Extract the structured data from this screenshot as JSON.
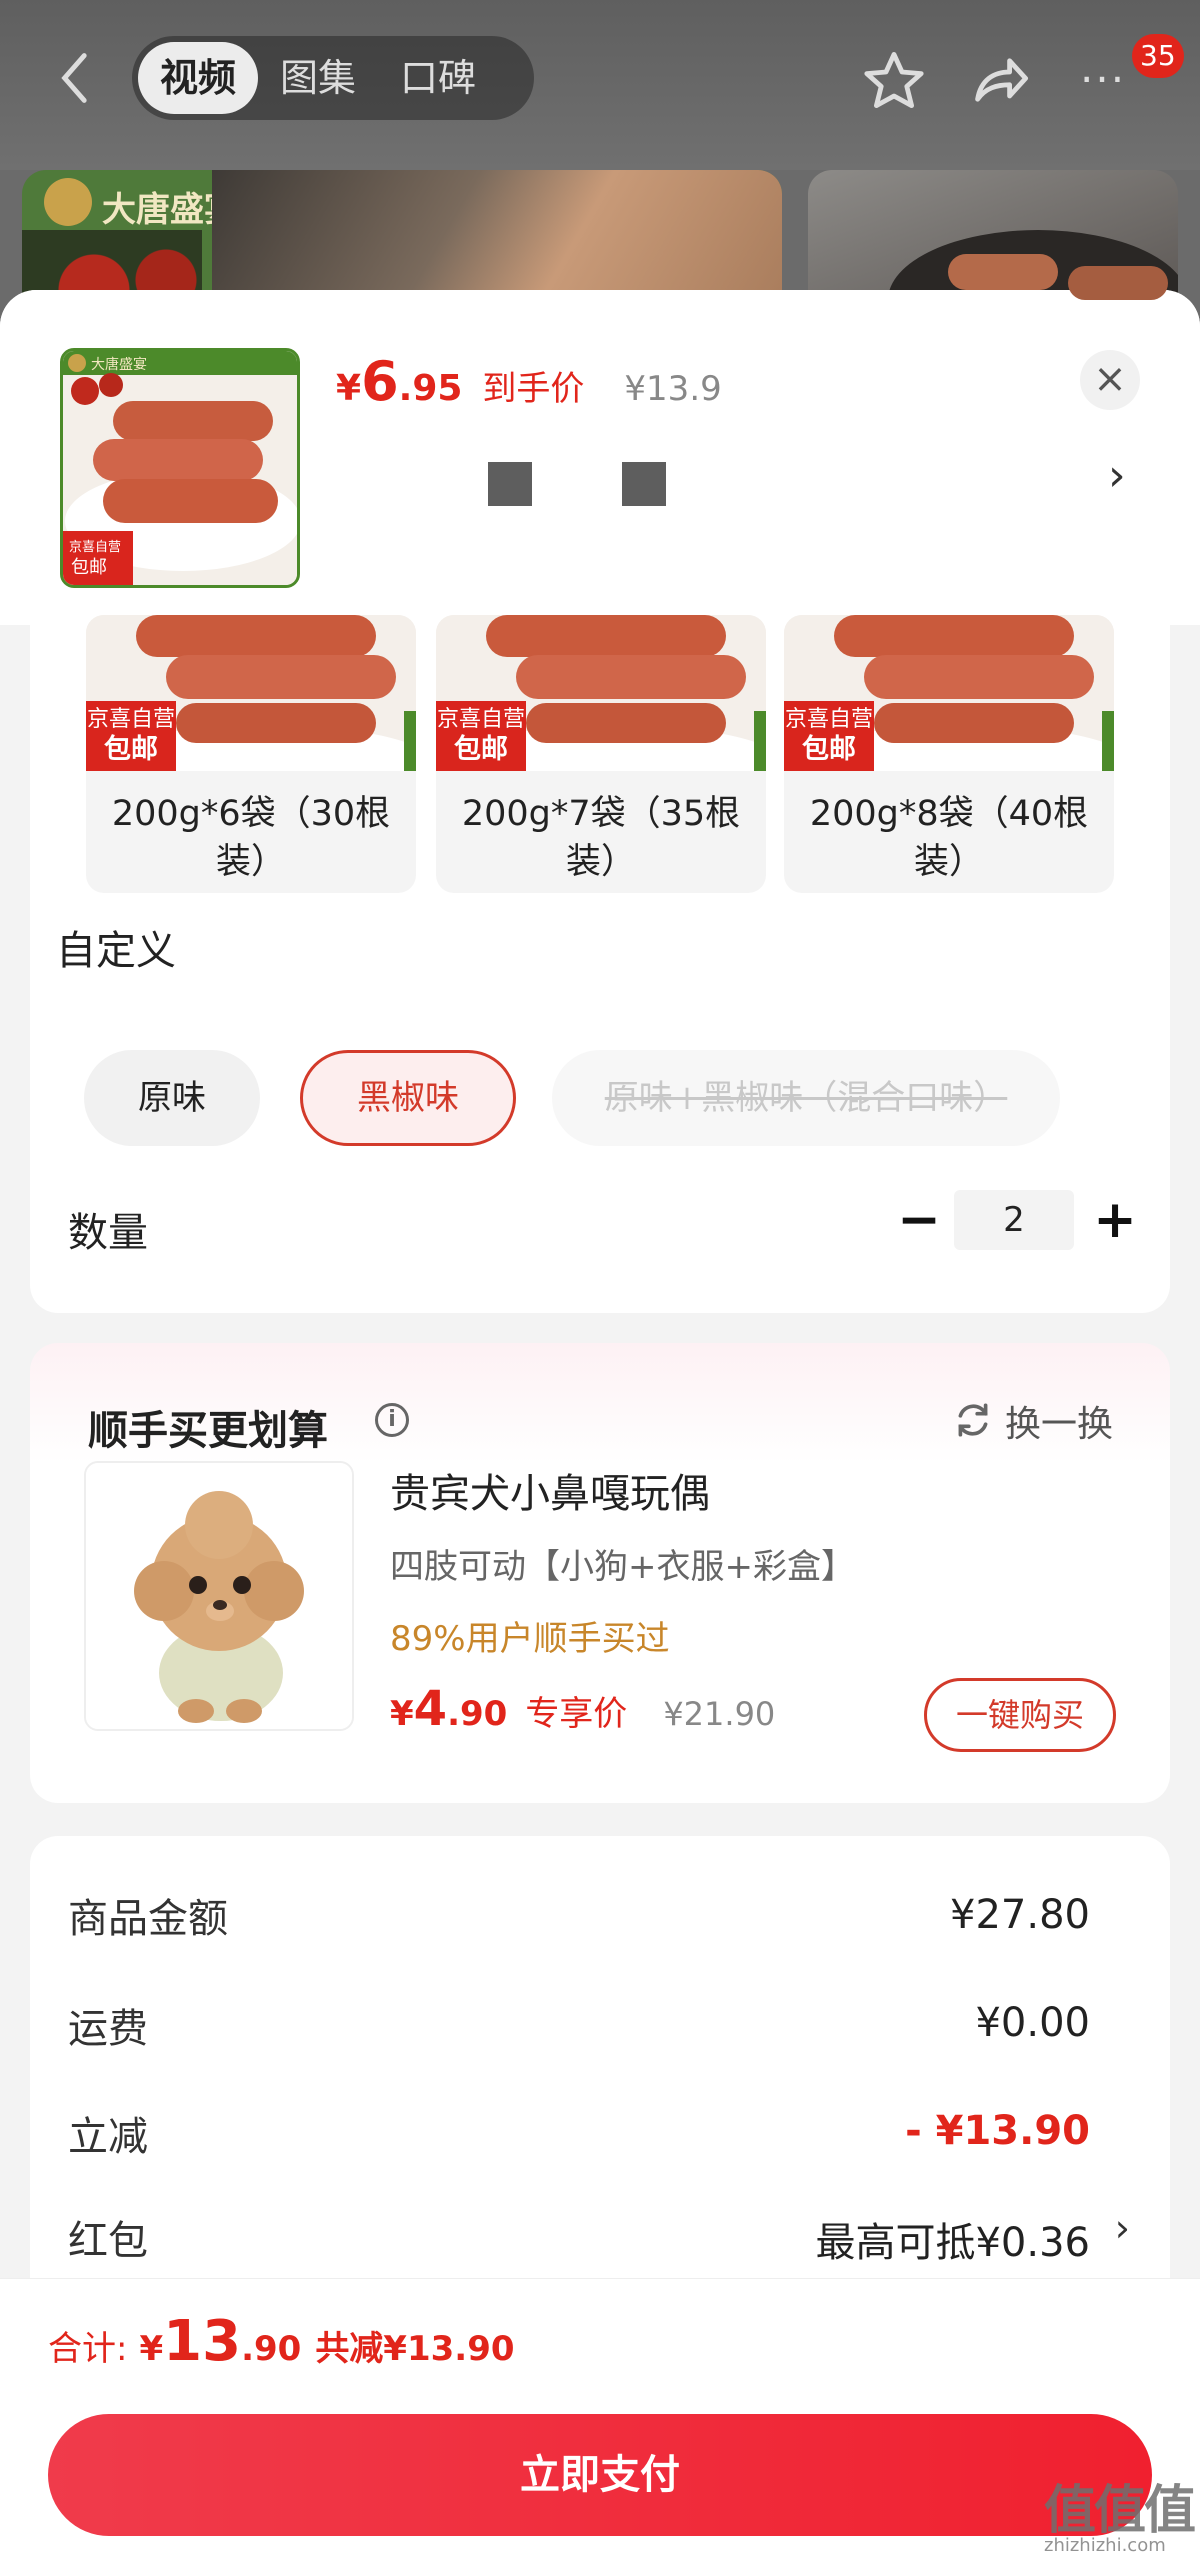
{
  "top_nav": {
    "tabs": [
      "视频",
      "图集",
      "口碑"
    ],
    "active_tab": 0,
    "badge_count": "35",
    "more_label": "···"
  },
  "background": {
    "brand_name": "大唐盛宴"
  },
  "sheet_header": {
    "price_symbol": "¥",
    "price_int": "6",
    "price_dec": ".95",
    "price_label": "到手价",
    "original_price": "¥13.9",
    "thumb_brand": "大唐盛宴",
    "thumb_tag_line1": "京喜自营",
    "thumb_tag_line2": "包邮",
    "close_glyph": "×",
    "chevron": "›"
  },
  "skus": [
    {
      "tag_line1": "京喜自营",
      "tag_line2": "包邮",
      "label": "200g*6袋（30根装）"
    },
    {
      "tag_line1": "京喜自营",
      "tag_line2": "包邮",
      "label": "200g*7袋（35根装）"
    },
    {
      "tag_line1": "京喜自营",
      "tag_line2": "包邮",
      "label": "200g*8袋（40根装）"
    }
  ],
  "flavor": {
    "title": "自定义",
    "options": [
      {
        "label": "原味",
        "state": "normal"
      },
      {
        "label": "黑椒味",
        "state": "selected"
      },
      {
        "label": "原味+黑椒味（混合口味）",
        "state": "disabled"
      }
    ]
  },
  "quantity": {
    "label": "数量",
    "minus": "−",
    "value": "2",
    "plus": "+"
  },
  "addon": {
    "title": "顺手买更划算",
    "info_glyph": "i",
    "refresh_label": "换一换",
    "name": "贵宾犬小鼻嘎玩偶",
    "desc": "四肢可动【小狗+衣服+彩盒】",
    "percent": "89%用户顺手买过",
    "price_symbol": "¥",
    "price_int": "4",
    "price_dec": ".90",
    "price_label": "专享价",
    "original_price": "¥21.90",
    "buy_label": "一键购买"
  },
  "summary": {
    "rows": [
      {
        "label": "商品金额",
        "value": "¥27.80"
      },
      {
        "label": "运费",
        "value": "¥0.00"
      },
      {
        "label": "立减",
        "value": "- ¥13.90"
      },
      {
        "label": "红包",
        "value": "最高可抵¥0.36"
      }
    ],
    "chevron": "›"
  },
  "bottom": {
    "total_label": "合计:",
    "total_symbol": "¥",
    "total_int": "13",
    "total_dec": ".90",
    "saved": "共减¥13.90",
    "pay_label": "立即支付"
  },
  "watermark": {
    "mark": "值值值",
    "site": "zhizhizhi.com"
  },
  "colors": {
    "accent_red": "#e1251b",
    "gold_text": "#c8862a",
    "pay_gradient_start": "#f03b4b",
    "pay_gradient_end": "#f0202f"
  }
}
